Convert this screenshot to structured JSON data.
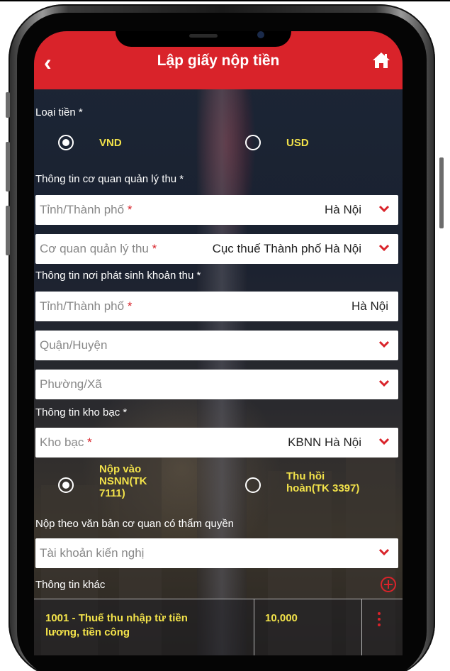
{
  "header": {
    "title": "Lập giấy nộp tiền",
    "back_icon": "back-chevron-icon",
    "home_icon": "home-icon"
  },
  "currency": {
    "label": "Loại tiền *",
    "options": [
      {
        "label": "VND",
        "selected": true
      },
      {
        "label": "USD",
        "selected": false
      }
    ]
  },
  "collection_authority": {
    "label": "Thông tin cơ quan quản lý thu *",
    "province": {
      "placeholder": "Tỉnh/Thành phố",
      "required": "*",
      "value": "Hà Nội"
    },
    "authority": {
      "placeholder": "Cơ quan quản lý thu",
      "required": "*",
      "value": "Cục thuế Thành phố Hà Nội"
    }
  },
  "revenue_origin": {
    "label": "Thông tin nơi phát sinh khoản thu *",
    "province": {
      "placeholder": "Tỉnh/Thành phố",
      "required": "*",
      "value": "Hà Nội"
    },
    "district": {
      "placeholder": "Quận/Huyện"
    },
    "ward": {
      "placeholder": "Phường/Xã"
    }
  },
  "treasury": {
    "label": "Thông tin kho bạc *",
    "field": {
      "placeholder": "Kho bạc",
      "required": "*",
      "value": "KBNN Hà Nội"
    },
    "options": [
      {
        "label": "Nộp vào NSNN(TK 7111)",
        "line1": "Nộp vào",
        "line2": "NSNN(TK",
        "line3": "7111)",
        "selected": true
      },
      {
        "label": "Thu hồi hoàn(TK 3397)",
        "line1": "Thu hồi",
        "line2": "hoàn(TK 3397)",
        "selected": false
      }
    ]
  },
  "authority_document": {
    "label": "Nộp theo văn bản cơ quan có thẩm quyền",
    "field": {
      "placeholder": "Tài khoản kiến nghị"
    }
  },
  "other_info": {
    "label": "Thông tin khác",
    "add_icon": "plus-circle-icon"
  },
  "items": [
    {
      "line1": "1001 - Thuế thu nhập từ tiền",
      "line2": "lương, tiền công",
      "amount": "10,000"
    }
  ],
  "colors": {
    "header": "#d9232a",
    "accent_text": "#f2e24a",
    "required": "#d9232a"
  }
}
